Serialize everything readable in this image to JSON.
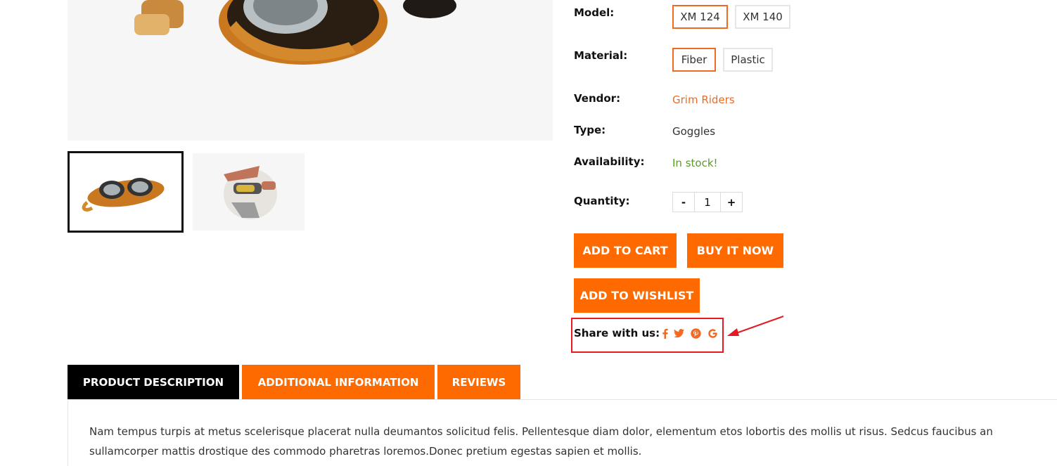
{
  "product": {
    "options": {
      "model_label": "Model:",
      "model_values": [
        "XM 124",
        "XM 140"
      ],
      "material_label": "Material:",
      "material_values": [
        "Fiber",
        "Plastic"
      ]
    },
    "vendor_label": "Vendor:",
    "vendor_value": "Grim Riders",
    "type_label": "Type:",
    "type_value": "Goggles",
    "availability_label": "Availability:",
    "availability_value": "In stock!",
    "quantity_label": "Quantity:",
    "quantity_minus": "-",
    "quantity_value": "1",
    "quantity_plus": "+"
  },
  "actions": {
    "add_to_cart": "ADD TO CART",
    "buy_it_now": "BUY IT NOW",
    "add_to_wishlist": "ADD TO WISHLIST"
  },
  "share": {
    "label": "Share with us:",
    "icons": [
      "facebook-icon",
      "twitter-icon",
      "pinterest-icon",
      "google-icon"
    ]
  },
  "tabs": [
    {
      "label": "PRODUCT DESCRIPTION",
      "active": true
    },
    {
      "label": "ADDITIONAL INFORMATION",
      "active": false
    },
    {
      "label": "REVIEWS",
      "active": false
    }
  ],
  "description": "Nam tempus turpis at metus scelerisque placerat nulla deumantos solicitud felis. Pellentesque diam dolor, elementum etos lobortis des mollis ut risus. Sedcus faucibus an sullamcorper mattis drostique des commodo pharetras loremos.Donec pretium egestas sapien et mollis.",
  "colors": {
    "accent": "#ff6a00",
    "link": "#f26a21",
    "in_stock": "#5c9a2b",
    "highlight": "#e31b23",
    "active_tab": "#000000"
  }
}
